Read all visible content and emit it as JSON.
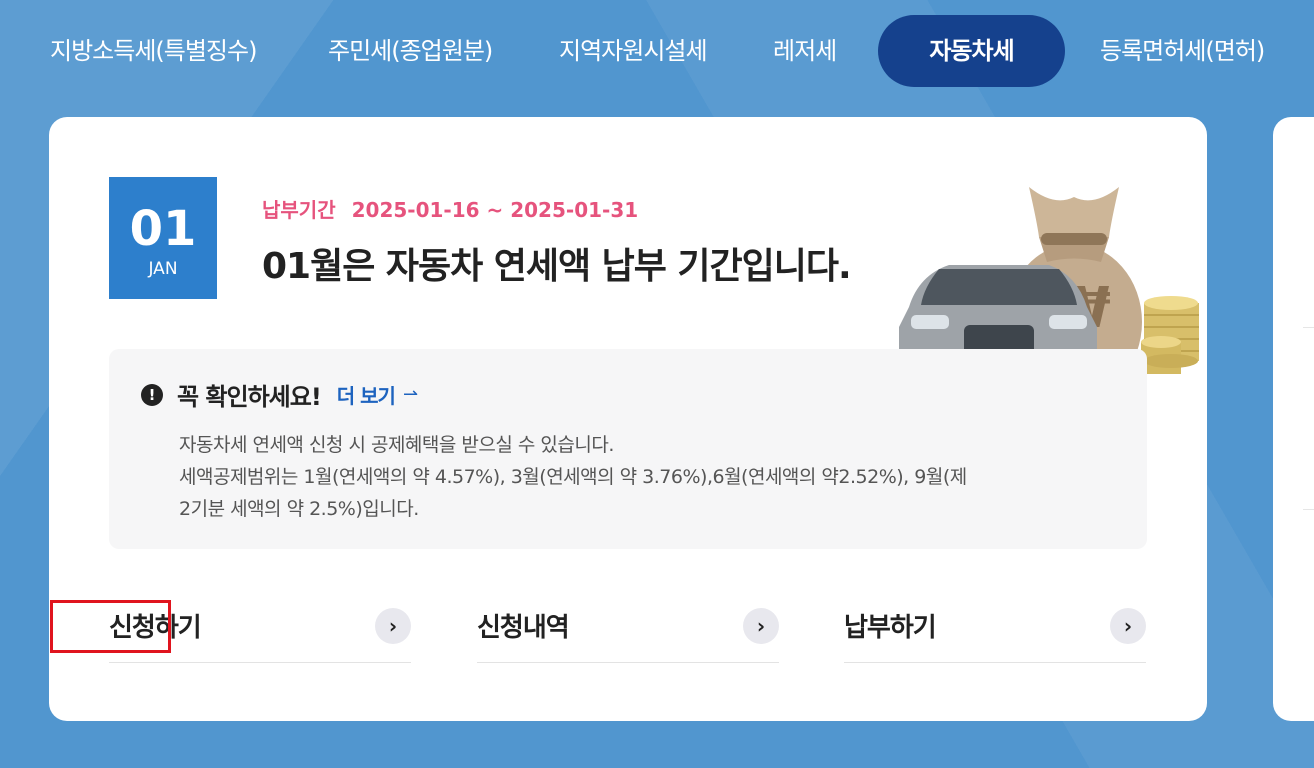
{
  "tabs": [
    {
      "label": "지방소득세(특별징수)"
    },
    {
      "label": "주민세(종업원분)"
    },
    {
      "label": "지역자원시설세"
    },
    {
      "label": "레저세"
    },
    {
      "label": "자동차세"
    },
    {
      "label": "등록면허세(면허)"
    }
  ],
  "active_tab": "자동차세",
  "card": {
    "date": {
      "day": "01",
      "month": "JAN"
    },
    "period_label": "납부기간",
    "period_value": "2025-01-16 ~ 2025-01-31",
    "headline": "01월은 자동차 연세액 납부 기간입니다.",
    "illustration": {
      "icons": [
        "car-icon",
        "money-bag-icon",
        "coin-stack-icon"
      ],
      "bag_symbol": "₩"
    },
    "notice": {
      "title": "꼭 확인하세요!",
      "more_label": "더 보기",
      "lines": [
        "자동차세 연세액 신청 시 공제혜택을 받으실 수 있습니다.",
        "세액공제범위는 1월(연세액의 약 4.57%), 3월(연세액의 약 3.76%),6월(연세액의 약2.52%), 9월(제",
        "2기분 세액의 약 2.5%)입니다."
      ]
    },
    "actions": [
      {
        "label": "신청하기"
      },
      {
        "label": "신청내역"
      },
      {
        "label": "납부하기"
      }
    ]
  },
  "colors": {
    "background": "#5196cf",
    "active_tab": "#15418d",
    "date_box": "#2d7fcc",
    "period_text": "#e6537d",
    "link": "#1d63bf",
    "highlight_border": "#e0141e"
  }
}
